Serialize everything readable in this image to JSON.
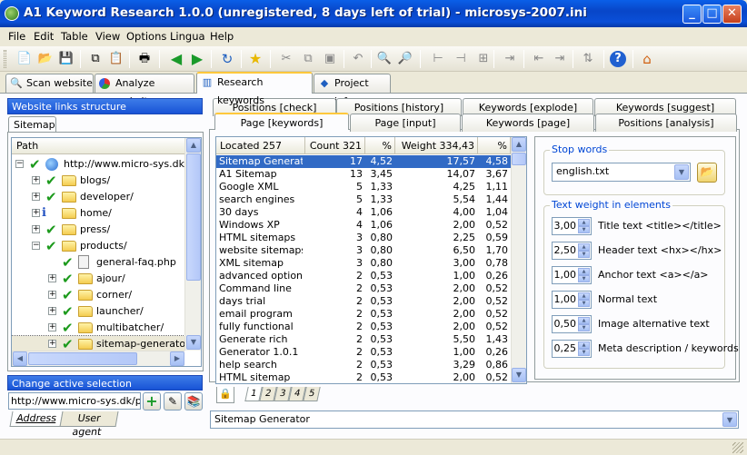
{
  "window": {
    "title": "A1 Keyword Research 1.0.0 (unregistered, 8 days left of trial) - microsys-2007.ini",
    "minimize": "_",
    "maximize": "□",
    "close": "✕"
  },
  "menu": [
    "File",
    "Edit",
    "Table",
    "View",
    "Options",
    "Lingua",
    "Help"
  ],
  "main_tabs": [
    "Scan website",
    "Analyze website",
    "Research keywords",
    "Project info"
  ],
  "left": {
    "links_header": "Website links structure",
    "sitemap_tab": "Sitemap",
    "path_header": "Path",
    "tree": [
      {
        "label": "http://www.micro-sys.dk/",
        "indent": 0,
        "type": "globe",
        "expander": "−"
      },
      {
        "label": "blogs/",
        "indent": 1,
        "type": "folder",
        "expander": "+"
      },
      {
        "label": "developer/",
        "indent": 1,
        "type": "folder",
        "expander": "+"
      },
      {
        "label": "home/",
        "indent": 1,
        "type": "folder",
        "expander": "+",
        "info": true
      },
      {
        "label": "press/",
        "indent": 1,
        "type": "folder",
        "expander": "+"
      },
      {
        "label": "products/",
        "indent": 1,
        "type": "folder",
        "expander": "−"
      },
      {
        "label": "general-faq.php",
        "indent": 2,
        "type": "file",
        "expander": ""
      },
      {
        "label": "ajour/",
        "indent": 2,
        "type": "folder",
        "expander": "+"
      },
      {
        "label": "corner/",
        "indent": 2,
        "type": "folder",
        "expander": "+"
      },
      {
        "label": "launcher/",
        "indent": 2,
        "type": "folder",
        "expander": "+"
      },
      {
        "label": "multibatcher/",
        "indent": 2,
        "type": "folder",
        "expander": "+"
      },
      {
        "label": "sitemap-generator/",
        "indent": 2,
        "type": "folder",
        "expander": "+"
      }
    ],
    "change_header": "Change active selection",
    "address_value": "http://www.micro-sys.dk/prod",
    "address_tabs": [
      "Address",
      "User agent"
    ]
  },
  "sub_tabs_row1": [
    "Positions [check]",
    "Positions [history]",
    "Keywords [explode]",
    "Keywords [suggest]"
  ],
  "sub_tabs_row2": [
    "Page [keywords]",
    "Page [input]",
    "Keywords [page]",
    "Positions [analysis]"
  ],
  "table": {
    "headers": [
      "Located 257",
      "Count 321",
      "%",
      "Weight 334,43",
      "%"
    ],
    "rows": [
      [
        "Sitemap Generator",
        "17",
        "4,52",
        "17,57",
        "4,58"
      ],
      [
        "A1 Sitemap",
        "13",
        "3,45",
        "14,07",
        "3,67"
      ],
      [
        "Google XML",
        "5",
        "1,33",
        "4,25",
        "1,11"
      ],
      [
        "search engines",
        "5",
        "1,33",
        "5,54",
        "1,44"
      ],
      [
        "30 days",
        "4",
        "1,06",
        "4,00",
        "1,04"
      ],
      [
        "Windows XP",
        "4",
        "1,06",
        "2,00",
        "0,52"
      ],
      [
        "HTML sitemaps",
        "3",
        "0,80",
        "2,25",
        "0,59"
      ],
      [
        "website sitemaps",
        "3",
        "0,80",
        "6,50",
        "1,70"
      ],
      [
        "XML sitemap",
        "3",
        "0,80",
        "3,00",
        "0,78"
      ],
      [
        "advanced options",
        "2",
        "0,53",
        "1,00",
        "0,26"
      ],
      [
        "Command line",
        "2",
        "0,53",
        "2,00",
        "0,52"
      ],
      [
        "days trial",
        "2",
        "0,53",
        "2,00",
        "0,52"
      ],
      [
        "email program",
        "2",
        "0,53",
        "2,00",
        "0,52"
      ],
      [
        "fully functional",
        "2",
        "0,53",
        "2,00",
        "0,52"
      ],
      [
        "Generate rich",
        "2",
        "0,53",
        "5,50",
        "1,43"
      ],
      [
        "Generator 1.0.1",
        "2",
        "0,53",
        "1,00",
        "0,26"
      ],
      [
        "help search",
        "2",
        "0,53",
        "3,29",
        "0,86"
      ],
      [
        "HTML sitemap",
        "2",
        "0,53",
        "2,00",
        "0,52"
      ]
    ],
    "page_tabs": [
      "1",
      "2",
      "3",
      "4",
      "5"
    ]
  },
  "stop_words": {
    "title": "Stop words",
    "value": "english.txt"
  },
  "text_weight": {
    "title": "Text weight in elements",
    "items": [
      {
        "value": "3,00",
        "label": "Title text <title></title>"
      },
      {
        "value": "2,50",
        "label": "Header text <hx></hx>"
      },
      {
        "value": "1,00",
        "label": "Anchor text <a></a>"
      },
      {
        "value": "1,00",
        "label": "Normal text"
      },
      {
        "value": "0,50",
        "label": "Image alternative text"
      },
      {
        "value": "0,25",
        "label": "Meta description / keywords"
      }
    ]
  },
  "bottom_combo": "Sitemap Generator"
}
